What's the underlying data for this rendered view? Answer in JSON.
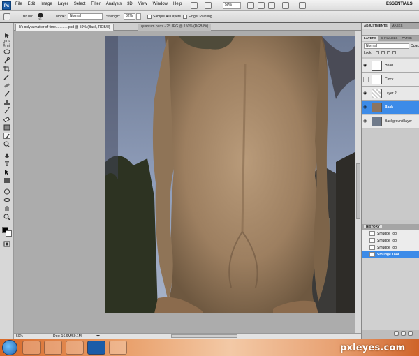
{
  "app": {
    "logo_text": "Ps",
    "menus": [
      "File",
      "Edit",
      "Image",
      "Layer",
      "Select",
      "Filter",
      "Analysis",
      "3D",
      "View",
      "Window",
      "Help"
    ],
    "zoom_level": "50%",
    "workspace": "ESSENTIALS"
  },
  "options_bar": {
    "brush_label": "Brush:",
    "brush_size": "35",
    "mode_label": "Mode:",
    "mode_value": "Normal",
    "strength_label": "Strength:",
    "strength_value": "82%",
    "sample_all_layers": "Sample All Layers",
    "finger_painting": "Finger Painting"
  },
  "tabs": [
    {
      "label": "It's only a matter of time.............psd @ 50% (Back, RGB/8)",
      "active": true
    },
    {
      "label": "quantum parts - 25.JPG @ 150% (RGB/8#)",
      "active": false
    }
  ],
  "status_bar": {
    "zoom": "50%",
    "doc_info": "Doc: 16.6M/59.1M"
  },
  "adjustments_panel": {
    "tabs": [
      "ADJUSTMENTS",
      "MASKS"
    ]
  },
  "layers_panel": {
    "tabs": [
      "LAYERS",
      "CHANNELS",
      "PATHS"
    ],
    "blend_mode": "Normal",
    "opacity_label": "Opac",
    "lock_label": "Lock:",
    "layers": [
      {
        "name": "Head",
        "visible": true,
        "selected": false
      },
      {
        "name": "Clock",
        "visible": false,
        "selected": false
      },
      {
        "name": "Layer 2",
        "visible": true,
        "selected": false
      },
      {
        "name": "Back",
        "visible": true,
        "selected": true
      },
      {
        "name": "Background layer",
        "visible": true,
        "selected": false
      }
    ]
  },
  "history_panel": {
    "title": "HISTORY",
    "steps": [
      {
        "name": "Smudge Tool",
        "selected": false
      },
      {
        "name": "Smudge Tool",
        "selected": false
      },
      {
        "name": "Smudge Tool",
        "selected": false
      },
      {
        "name": "Smudge Tool",
        "selected": true
      }
    ]
  },
  "watermark": "pxleyes.com",
  "colors": {
    "selection": "#3c8be8",
    "workspace_bg": "#acacac",
    "taskbar": "#e9a06b"
  }
}
